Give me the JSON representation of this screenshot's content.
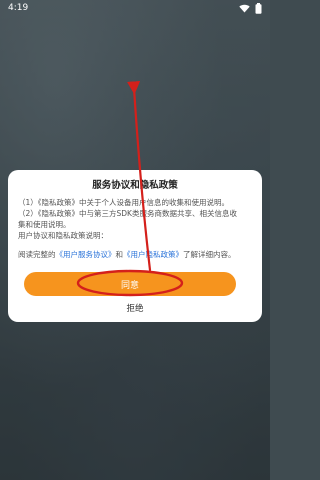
{
  "status": {
    "time": "4:19"
  },
  "dialog": {
    "title": "服务协议和隐私政策",
    "lines": [
      "（1）《隐私政策》中关于个人设备用户信息的收集和使用说明。",
      "（2）《隐私政策》中与第三方SDK类服务商数据共享、相关信息收",
      "集和使用说明。",
      "用户协议和隐私政策说明："
    ],
    "links_prefix": "阅读完整的",
    "link_user_agreement": "《用户服务协议》",
    "links_and": "和",
    "link_privacy": "《用户隐私政策》",
    "links_suffix": "了解详细内容。",
    "agree_label": "同意",
    "reject_label": "拒绝"
  },
  "colors": {
    "accent": "#f6941e",
    "link": "#2a73d9",
    "annotation": "#d4201b"
  }
}
